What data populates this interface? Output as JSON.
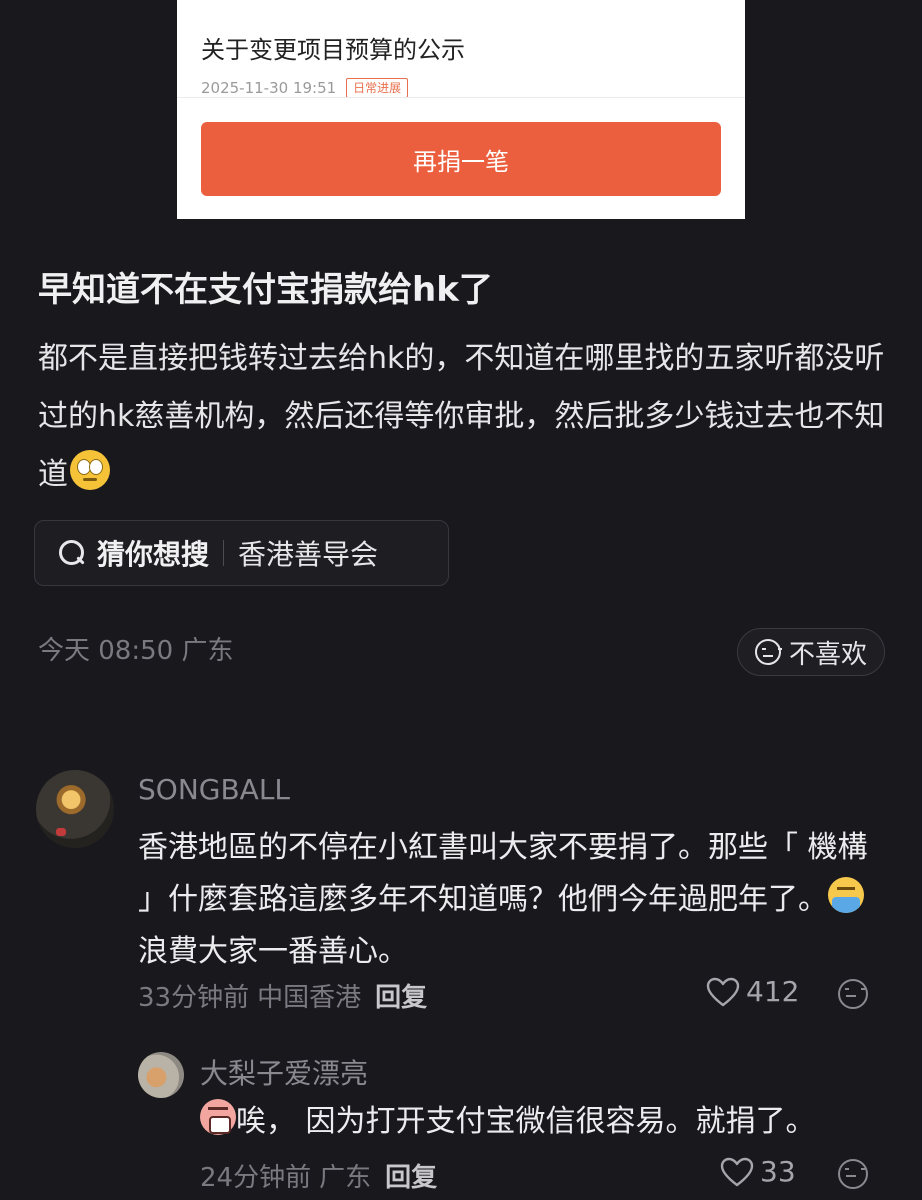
{
  "embedded_card": {
    "title": "关于变更项目预算的公示",
    "timestamp": "2025-11-30 19:51",
    "tag": "日常进展",
    "button_label": "再捐一笔",
    "button_color": "#ec5f3e"
  },
  "post": {
    "title": "早知道不在支付宝捐款给hk了",
    "body": "都不是直接把钱转过去给hk的，不知道在哪里找的五家听都没听过的hk慈善机构，然后还得等你审批，然后批多少钱过去也不知道",
    "body_emoji": "face-with-rolling-eyes",
    "search_chip": {
      "label": "猜你想搜",
      "term": "香港善导会",
      "icon": "search-icon"
    },
    "meta": "今天 08:50 广东",
    "dislike_label": "不喜欢"
  },
  "comments": [
    {
      "username": "SONGBALL",
      "text_before_emoji": "香港地區的不停在小紅書叫大家不要捐了。那些「 機構 」什麼套路這麼多年不知道嗎？他們今年過肥年了。",
      "emoji": "crying-bath-emoji",
      "text_after_emoji": "浪費大家一番善心。",
      "time": "33分钟前",
      "location": "中国香港",
      "reply_label": "回复",
      "likes": "412"
    },
    {
      "username": "大梨子爱漂亮",
      "emoji": "screaming-emoji",
      "text": "唉， 因为打开支付宝微信很容易。就捐了。",
      "time": "24分钟前",
      "location": "广东",
      "reply_label": "回复",
      "likes": "33"
    }
  ]
}
